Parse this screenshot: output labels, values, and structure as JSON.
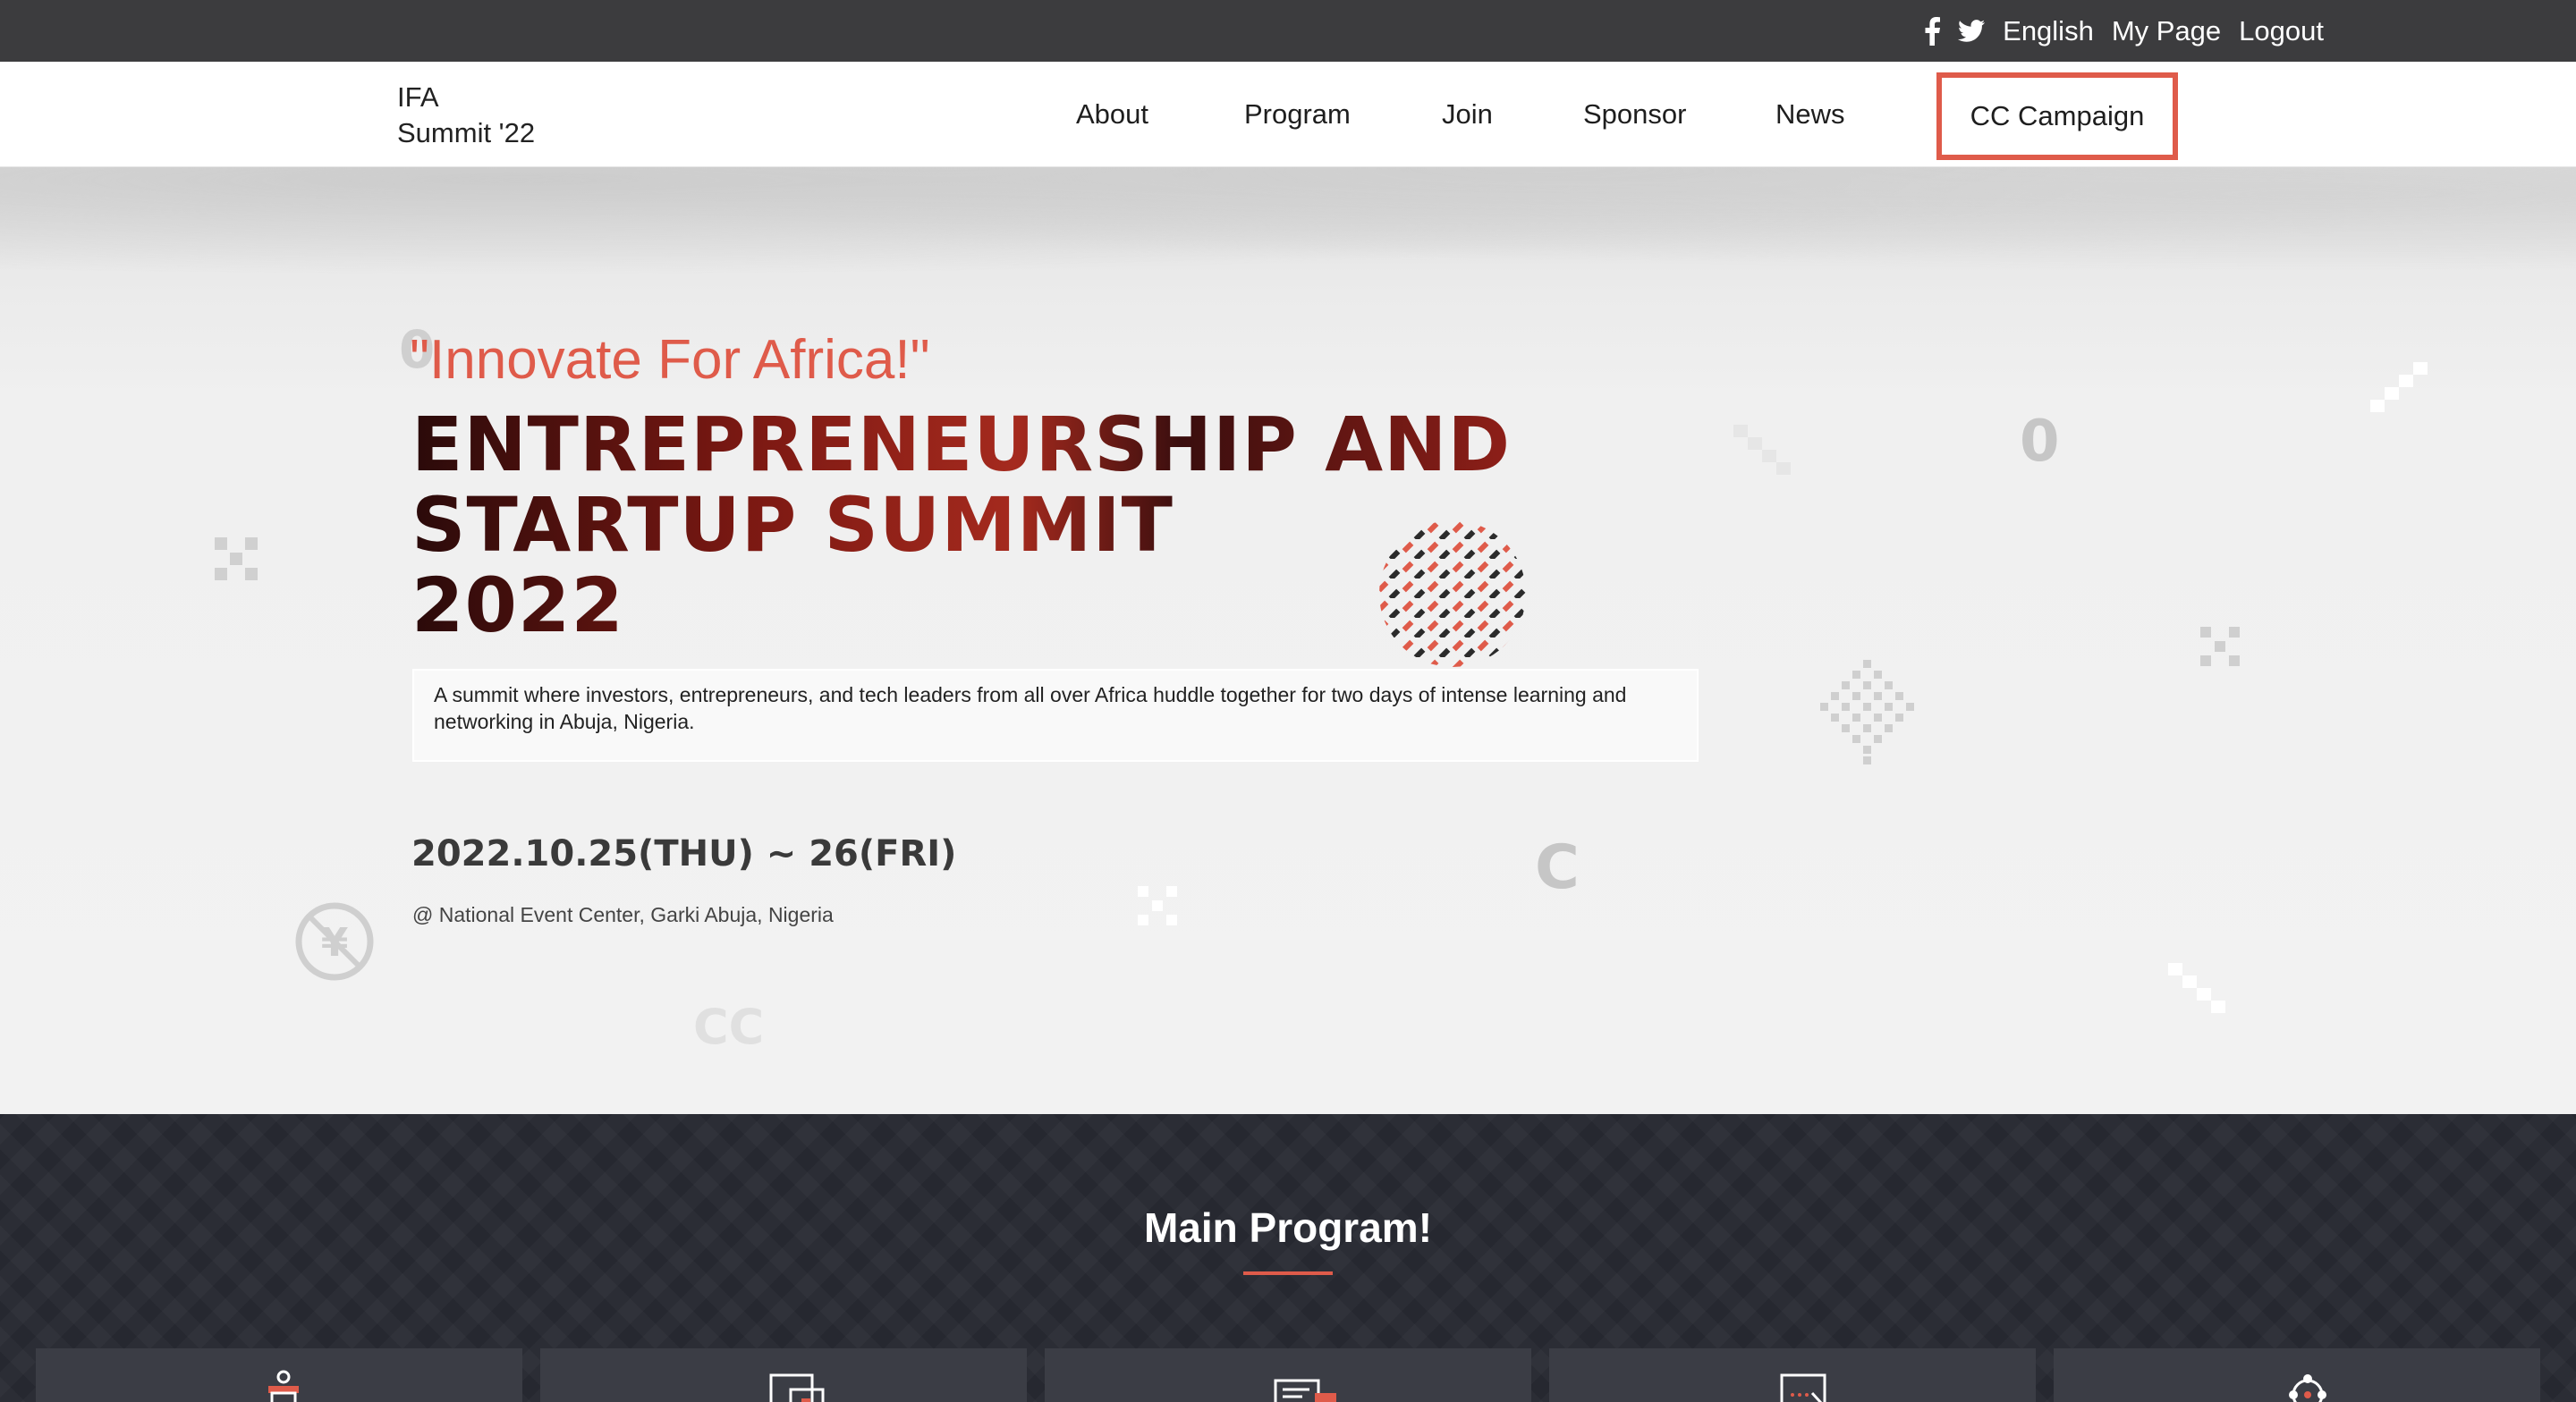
{
  "topbar": {
    "icons": [
      "facebook-icon",
      "twitter-icon"
    ],
    "language": "English",
    "mypage": "My Page",
    "logout": "Logout"
  },
  "logo": {
    "line1": "IFA",
    "line2": "Summit '22"
  },
  "nav": {
    "items": [
      "About",
      "Program",
      "Join",
      "Sponsor",
      "News"
    ],
    "highlighted": "CC Campaign"
  },
  "hero": {
    "slogan": "\"Innovate For Africa!\"",
    "title_lines": [
      "ENTREPRENEURSHIP AND",
      "STARTUP SUMMIT",
      "2022"
    ],
    "description": "A summit where investors, entrepreneurs, and tech leaders from all over Africa huddle together for two days of intense learning and networking in Abuja, Nigeria.",
    "date": "2022.10.25(THU) ~ 26(FRI)",
    "venue": "@ National Event Center, Garki Abuja, Nigeria"
  },
  "program": {
    "title": "Main Program!",
    "card_icons": [
      "podium-icon",
      "presentation-icon",
      "document-icon",
      "pen-board-icon",
      "network-icon"
    ]
  },
  "colors": {
    "accent": "#df5b4a",
    "topbar": "#3c3c3e",
    "dark_section": "#262830"
  }
}
